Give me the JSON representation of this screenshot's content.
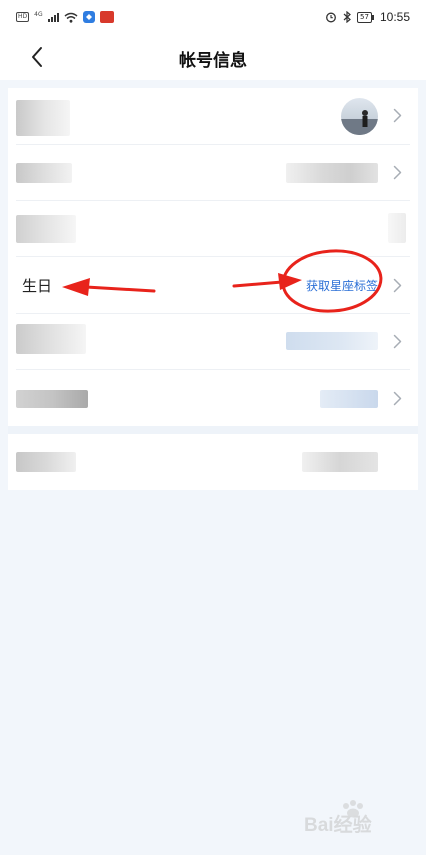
{
  "status_bar": {
    "time": "10:55",
    "network": "4G",
    "hd": "HD",
    "battery": "57"
  },
  "header": {
    "title": "帐号信息",
    "back_icon": "chevron-left-icon"
  },
  "rows": [
    {
      "label": "",
      "value_kind": "avatar"
    },
    {
      "label": "",
      "value_kind": "blurred"
    },
    {
      "label": "",
      "value_kind": "blurred"
    },
    {
      "label": "生日",
      "value": "获取星座标签",
      "value_kind": "link"
    },
    {
      "label": "",
      "value_kind": "blurred"
    },
    {
      "label": "",
      "value_kind": "blurred"
    },
    {
      "label": "",
      "value_kind": "blurred"
    }
  ],
  "colors": {
    "accent": "#2b6fd6",
    "annotation_red": "#e8231b",
    "page_bg": "#f2f6fb"
  },
  "watermark": {
    "text": "Bai经验"
  }
}
